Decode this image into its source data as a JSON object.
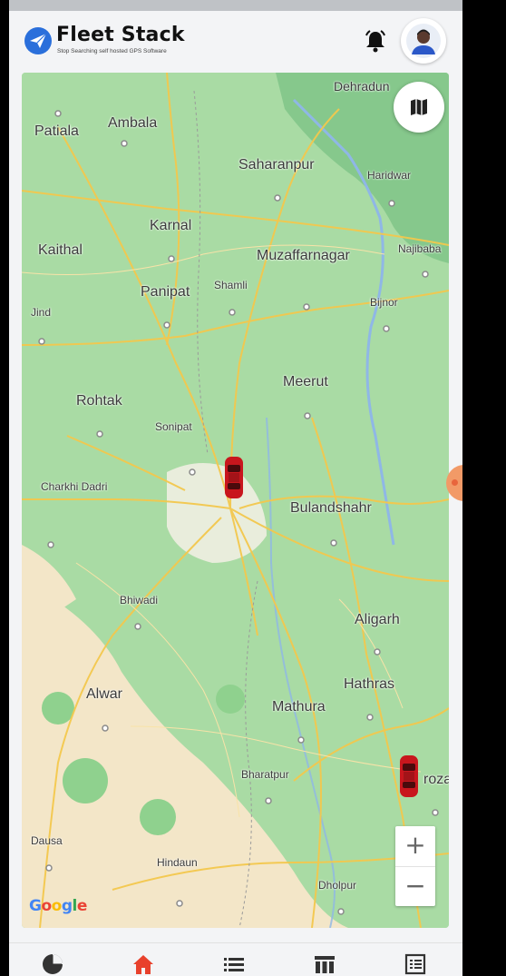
{
  "app": {
    "brand": "Fleet Stack",
    "tagline": "Stop Searching self hosted GPS Software"
  },
  "header_icons": [
    "notification-bell-icon",
    "user-avatar"
  ],
  "map": {
    "attribution": "Google",
    "map_type_icon": "map-layers-icon",
    "zoom_in_label": "+",
    "zoom_out_label": "−",
    "places": [
      {
        "name": "Dehradun",
        "key": "dehradun"
      },
      {
        "name": "Ambala",
        "key": "ambala"
      },
      {
        "name": "Patiala",
        "key": "patiala"
      },
      {
        "name": "Saharanpur",
        "key": "saharanpur"
      },
      {
        "name": "Haridwar",
        "key": "haridwar"
      },
      {
        "name": "Karnal",
        "key": "karnal"
      },
      {
        "name": "Kaithal",
        "key": "kaithal"
      },
      {
        "name": "Muzaffarnagar",
        "key": "muzaffarnagar"
      },
      {
        "name": "Najibaba",
        "key": "najibabad"
      },
      {
        "name": "Panipat",
        "key": "panipat"
      },
      {
        "name": "Shamli",
        "key": "shamli"
      },
      {
        "name": "Bijnor",
        "key": "bijnor"
      },
      {
        "name": "Jind",
        "key": "jind"
      },
      {
        "name": "Meerut",
        "key": "meerut"
      },
      {
        "name": "Rohtak",
        "key": "rohtak"
      },
      {
        "name": "Sonipat",
        "key": "sonipat"
      },
      {
        "name": "Charkhi Dadri",
        "key": "charkhi-dadri"
      },
      {
        "name": "Bulandshahr",
        "key": "bulandshahr"
      },
      {
        "name": "Bhiwadi",
        "key": "bhiwadi"
      },
      {
        "name": "Aligarh",
        "key": "aligarh"
      },
      {
        "name": "Alwar",
        "key": "alwar"
      },
      {
        "name": "Hathras",
        "key": "hathras"
      },
      {
        "name": "Mathura",
        "key": "mathura"
      },
      {
        "name": "Bharatpur",
        "key": "bharatpur"
      },
      {
        "name": "rozab",
        "key": "firozabad"
      },
      {
        "name": "Dausa",
        "key": "dausa"
      },
      {
        "name": "Hindaun",
        "key": "hindaun"
      },
      {
        "name": "Dholpur",
        "key": "dholpur"
      }
    ],
    "vehicles": [
      {
        "id": "vehicle-1",
        "icon": "red-car-icon"
      },
      {
        "id": "vehicle-2",
        "icon": "red-car-icon"
      }
    ]
  },
  "bottom_nav": [
    {
      "key": "dashboard",
      "icon": "pie-chart-icon"
    },
    {
      "key": "home",
      "icon": "home-icon",
      "active": true
    },
    {
      "key": "list",
      "icon": "list-icon"
    },
    {
      "key": "table",
      "icon": "table-icon"
    },
    {
      "key": "reports",
      "icon": "report-icon"
    }
  ],
  "colors": {
    "accent": "#e8412c",
    "brand_blue": "#2a6fdb",
    "map_green": "#a9dba4",
    "vehicle_red": "#c8161d"
  }
}
